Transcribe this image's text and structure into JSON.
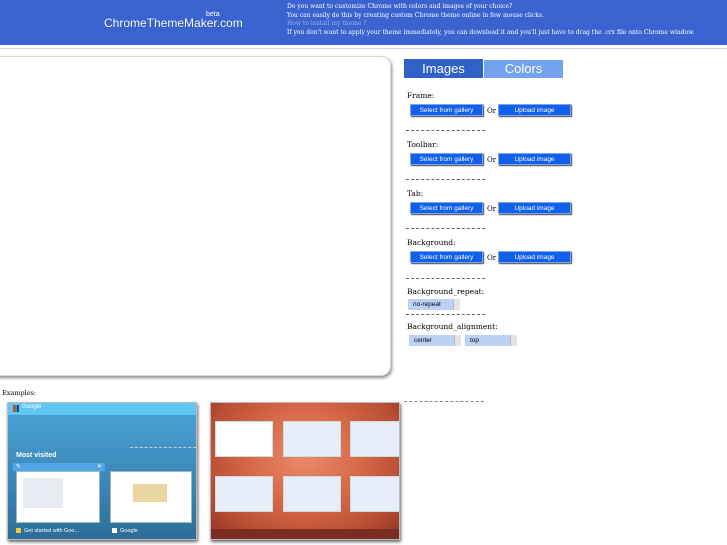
{
  "header": {
    "logo": "ChromeThemeMaker.com",
    "beta": "beta",
    "info_line1": "Do you want to customize Chrome with colors and images of your choice?",
    "info_line2": "You can easily do this by creating custom Chrome theme online in few mouse clicks.",
    "info_link": "How to install my theme ?",
    "info_line3": "If you don't want to apply your theme immediately, you can download it and you'll just have to drag the .crx file onto Chrome window."
  },
  "tabs": {
    "images": "Images",
    "colors": "Colors"
  },
  "sections": {
    "frame": "Frame:",
    "toolbar": "Toolbar:",
    "tab": "Tab:",
    "background": "Background:",
    "background_repeat": "Background_repeat:",
    "background_alignment": "Background_alignment:"
  },
  "buttons": {
    "gallery": "Select from gallery",
    "or": "Or",
    "upload": "Upload image"
  },
  "selects": {
    "repeat": "no-repeat",
    "align_h": "center",
    "align_v": "top"
  },
  "examples": {
    "label": "Examples:",
    "ex1": {
      "google": "Google",
      "most_visited": "Most visited",
      "caption1": "Get started with Goo...",
      "caption2": "Google",
      "pin": "✎",
      "close": "✕"
    }
  },
  "colors": {
    "header_bg": "#3a63cf",
    "tab_active": "#2f61c9",
    "tab_inactive": "#74a2ee",
    "button_bg": "#1060ea"
  }
}
